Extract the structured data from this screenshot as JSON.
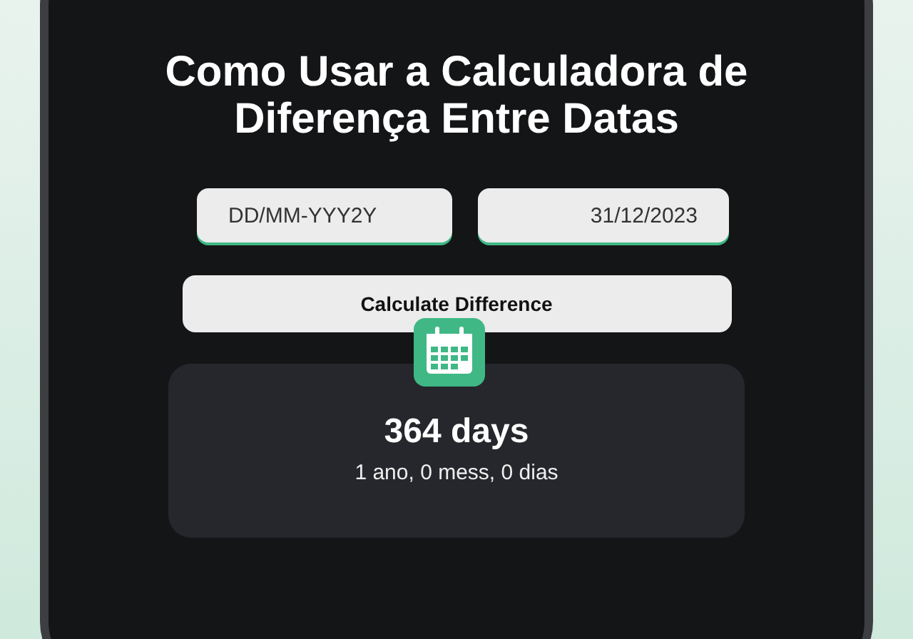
{
  "title": "Como Usar a Calculadora de Diferença Entre Datas",
  "start_date": {
    "placeholder": "DD/MM-YYY2Y"
  },
  "end_date": {
    "value": "31/12/2023"
  },
  "calculate_button": "Calculate Difference",
  "result": {
    "days": "364 days",
    "breakdown": "1 ano, 0 mess, 0 dias"
  }
}
